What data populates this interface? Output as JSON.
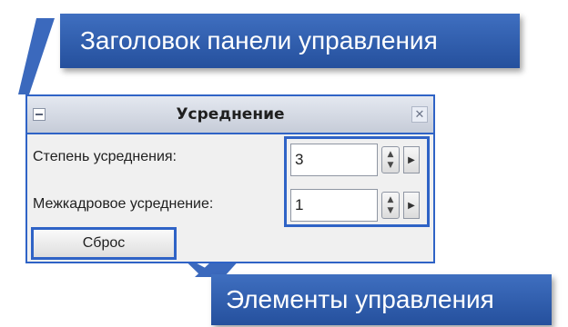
{
  "callouts": {
    "top": "Заголовок панели управления",
    "bottom": "Элементы управления"
  },
  "panel": {
    "title": "Усреднение",
    "rows": [
      {
        "label": "Степень усреднения:",
        "value": "3"
      },
      {
        "label": "Межкадровое усреднение:",
        "value": "1"
      }
    ],
    "reset_label": "Сброс"
  },
  "icons": {
    "collapse": "minus-icon",
    "close": "close-icon",
    "spin": "spin-arrows-icon",
    "expand": "chevron-right-icon"
  },
  "colors": {
    "callout_fill": "#2f5ba8",
    "highlight_border": "#2f63c6",
    "panel_bg": "#f0f0f0"
  }
}
